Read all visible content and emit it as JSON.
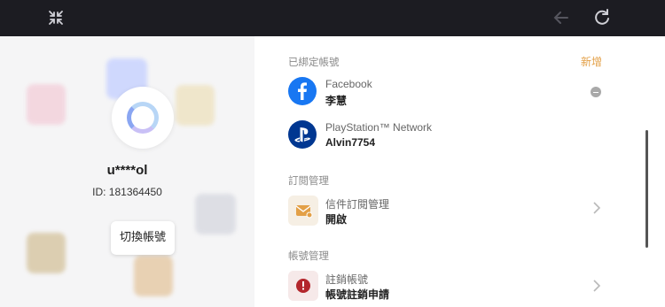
{
  "header": {
    "close_icon": "collapse-icon",
    "back_icon": "back-arrow-icon",
    "refresh_icon": "refresh-icon"
  },
  "profile": {
    "username": "u****ol",
    "id_text": "ID: 181364450",
    "switch_label": "切換帳號"
  },
  "sections": {
    "bound": {
      "title": "已綁定帳號",
      "add_label": "新增",
      "items": [
        {
          "platform": "Facebook",
          "account": "李慧"
        },
        {
          "platform": "PlayStation™ Network",
          "account": "Alvin7754"
        }
      ]
    },
    "subscription": {
      "title": "訂閱管理",
      "item": {
        "title": "信件訂閱管理",
        "value": "開啟"
      }
    },
    "account": {
      "title": "帳號管理",
      "item": {
        "title": "註銷帳號",
        "value": "帳號註銷申請"
      }
    }
  },
  "colors": {
    "accent": "#e3a047",
    "facebook": "#1877f2",
    "playstation": "#003791",
    "danger": "#b3262c"
  }
}
